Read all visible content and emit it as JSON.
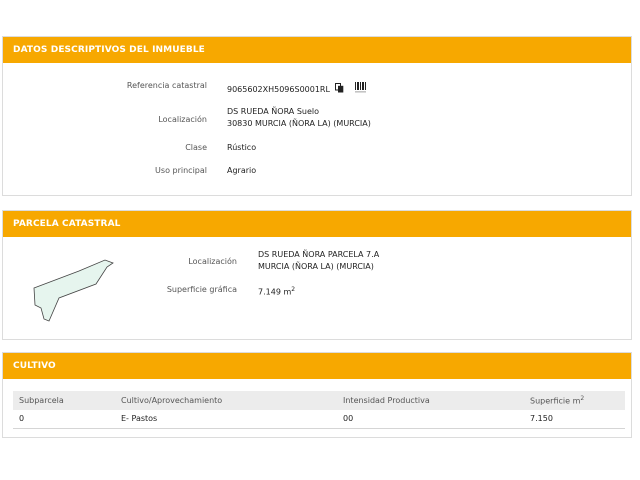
{
  "descriptive": {
    "title": "DATOS DESCRIPTIVOS DEL INMUEBLE",
    "ref_label": "Referencia catastral",
    "ref_value": "9065602XH5096S0001RL",
    "loc_label": "Localización",
    "loc_line1": "DS RUEDA ÑORA Suelo",
    "loc_line2": "30830 MURCIA (ÑORA LA) (MURCIA)",
    "clase_label": "Clase",
    "clase_value": "Rústico",
    "uso_label": "Uso principal",
    "uso_value": "Agrario"
  },
  "parcela": {
    "title": "PARCELA CATASTRAL",
    "loc_label": "Localización",
    "loc_line1": "DS RUEDA ÑORA PARCELA 7.A",
    "loc_line2": "MURCIA (ÑORA LA) (MURCIA)",
    "sup_label": "Superficie gráfica",
    "sup_value": "7.149 m",
    "sup_unit_exp": "2",
    "map_fill": "#e6f5ee"
  },
  "cultivo": {
    "title": "CULTIVO",
    "headers": [
      "Subparcela",
      "Cultivo/Aprovechamiento",
      "Intensidad Productiva",
      "Superficie m"
    ],
    "header_exp": "2",
    "rows": [
      [
        "0",
        "E- Pastos",
        "00",
        "7.150"
      ]
    ]
  },
  "icons": [
    "copy-icon",
    "barcode-icon"
  ],
  "colors": {
    "header": "#f7a800"
  }
}
